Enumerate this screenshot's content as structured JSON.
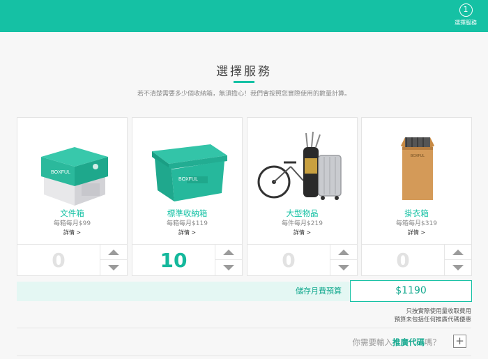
{
  "header": {
    "step_number": "1",
    "step_label": "選擇服務",
    "brand_color": "#15c1a4"
  },
  "title": "選擇服務",
  "subtitle": "若不清楚需要多少個收納箱，無須擔心！我們會按照您實際使用的數量計算。",
  "cards": [
    {
      "name": "文件箱",
      "price": "每箱每月$99",
      "more": "詳情 >",
      "qty": "0",
      "icon": "document-box-image"
    },
    {
      "name": "標準收納箱",
      "price": "每箱每月$119",
      "more": "詳情 >",
      "qty": "10",
      "icon": "storage-bin-image"
    },
    {
      "name": "大型物品",
      "price": "每件每月$219",
      "more": "詳情 >",
      "qty": "0",
      "icon": "large-items-image"
    },
    {
      "name": "掛衣箱",
      "price": "每箱每月$319",
      "more": "詳情 >",
      "qty": "0",
      "icon": "wardrobe-box-image"
    }
  ],
  "budget": {
    "label": "儲存月費預算",
    "value": "$1190"
  },
  "notes": {
    "line1": "只按實際使用量收取費用",
    "line2": "預算未包括任何推廣代碼優惠"
  },
  "promo": {
    "prefix": "你需要輸入",
    "highlight": "推廣代碼",
    "suffix": "嗎？",
    "button": "+"
  }
}
